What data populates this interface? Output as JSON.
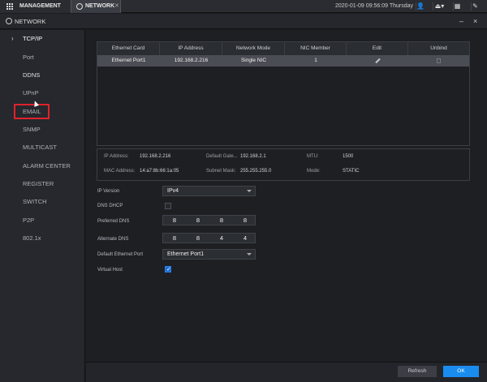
{
  "topbar": {
    "management_label": "MANAGEMENT",
    "network_tab_label": "NETWORK",
    "datetime": "2020-01-09 09:56:09 Thursday"
  },
  "window": {
    "title": "NETWORK",
    "minimize": "–",
    "close": "×"
  },
  "sidebar": {
    "items": [
      {
        "label": "TCP/IP"
      },
      {
        "label": "Port"
      },
      {
        "label": "DDNS"
      },
      {
        "label": "UPnP"
      },
      {
        "label": "EMAIL"
      },
      {
        "label": "SNMP"
      },
      {
        "label": "MULTICAST"
      },
      {
        "label": "ALARM CENTER"
      },
      {
        "label": "REGISTER"
      },
      {
        "label": "SWITCH"
      },
      {
        "label": "P2P"
      },
      {
        "label": "802.1x"
      }
    ]
  },
  "table": {
    "headers": [
      "Ethernet Card",
      "IP Address",
      "Network Mode",
      "NIC Member",
      "Edit",
      "Unbind"
    ],
    "rows": [
      {
        "card": "Ethernet Port1",
        "ip": "192.168.2.216",
        "mode": "Single NIC",
        "member": "1"
      }
    ]
  },
  "info": {
    "ip_label": "IP Address:",
    "ip_value": "192.168.2.216",
    "gw_label": "Default Gate...",
    "gw_value": "192.168.2.1",
    "mtu_label": "MTU:",
    "mtu_value": "1500",
    "mac_label": "MAC Address:",
    "mac_value": "14:a7:8b:66:1a:05",
    "mask_label": "Subnet Mask:",
    "mask_value": "255.255.255.0",
    "mode_label": "Mode:",
    "mode_value": "STATIC"
  },
  "form": {
    "ip_version_label": "IP Version",
    "ip_version_value": "IPv4",
    "dns_dhcp_label": "DNS DHCP",
    "preferred_dns_label": "Preferred DNS",
    "preferred_dns": [
      "8",
      "8",
      "8",
      "8"
    ],
    "alternate_dns_label": "Alternate DNS",
    "alternate_dns": [
      "8",
      "8",
      "4",
      "4"
    ],
    "default_port_label": "Default Ethernet Port",
    "default_port_value": "Ethernet Port1",
    "virtual_host_label": "Virtual Host"
  },
  "buttons": {
    "refresh": "Refresh",
    "ok": "OK"
  }
}
